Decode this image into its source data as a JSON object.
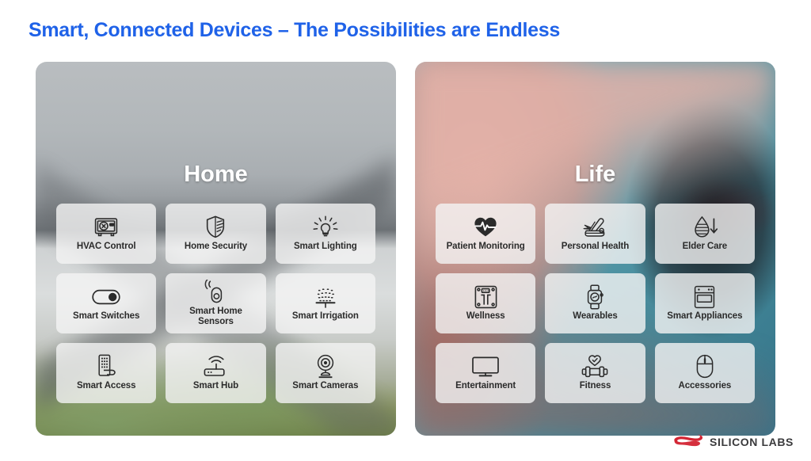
{
  "slide": {
    "title": "Smart, Connected Devices – The Possibilities are Endless",
    "title_color": "#1f62e8",
    "background_color": "#ffffff"
  },
  "panels": [
    {
      "id": "home",
      "heading": "Home",
      "heading_color": "#ffffff",
      "background_description": "blurred photo of a modern gray house exterior with lawn",
      "cards": [
        {
          "label": "HVAC Control",
          "icon": "safe-box-icon"
        },
        {
          "label": "Home Security",
          "icon": "shield-icon"
        },
        {
          "label": "Smart Lighting",
          "icon": "lightbulb-icon"
        },
        {
          "label": "Smart Switches",
          "icon": "toggle-switch-icon"
        },
        {
          "label": "Smart Home\nSensors",
          "icon": "motion-sensor-icon"
        },
        {
          "label": "Smart Irrigation",
          "icon": "sprinkler-icon"
        },
        {
          "label": "Smart Access",
          "icon": "keypad-lock-icon"
        },
        {
          "label": "Smart Hub",
          "icon": "router-icon"
        },
        {
          "label": "Smart Cameras",
          "icon": "security-camera-icon"
        }
      ]
    },
    {
      "id": "life",
      "heading": "Life",
      "heading_color": "#ffffff",
      "background_description": "blurred photo of a finger in a pulse oximeter on a teal surface",
      "cards": [
        {
          "label": "Patient Monitoring",
          "icon": "heart-pulse-icon"
        },
        {
          "label": "Personal Health",
          "icon": "multitool-icon"
        },
        {
          "label": "Elder Care",
          "icon": "droplet-down-arrow-icon"
        },
        {
          "label": "Wellness",
          "icon": "bathroom-scale-icon"
        },
        {
          "label": "Wearables",
          "icon": "smartwatch-icon"
        },
        {
          "label": "Smart Appliances",
          "icon": "oven-icon"
        },
        {
          "label": "Entertainment",
          "icon": "television-icon"
        },
        {
          "label": "Fitness",
          "icon": "dumbbell-heart-icon"
        },
        {
          "label": "Accessories",
          "icon": "computer-mouse-icon"
        }
      ]
    }
  ],
  "logo": {
    "text": "SILICON LABS",
    "mark": "silicon-labs-swoosh-icon",
    "mark_color": "#d32433",
    "text_color": "#3a3a3c"
  }
}
